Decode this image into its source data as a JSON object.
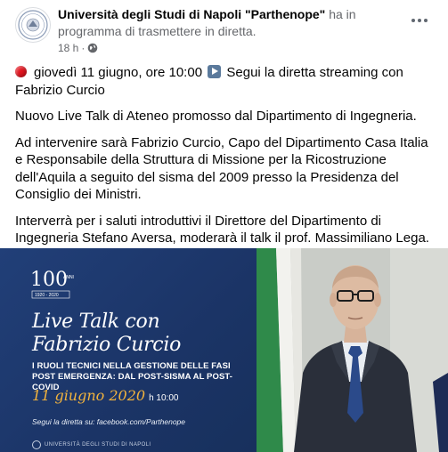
{
  "post": {
    "author_name": "Università degli Studi di Napoli \"Parthenope\"",
    "author_action": " ha in programma di trasmettere in diretta.",
    "timestamp": "18 h",
    "separator": "·",
    "privacy_icon": "globe-icon",
    "more_icon": "more-options-icon"
  },
  "body": {
    "p1_date": "giovedì 11 giugno, ore 10:00",
    "p1_rest": "Segui la diretta streaming con Fabrizio Curcio",
    "p2": "Nuovo Live Talk di Ateneo promosso dal Dipartimento di Ingegneria.",
    "p3": "Ad intervenire sarà Fabrizio Curcio, Capo del Dipartimento Casa Italia e Responsabile della Struttura di Missione per la Ricostruzione dell'Aquila a seguito del sisma del 2009 presso la Presidenza del Consiglio dei Ministri.",
    "p4": "Interverrà per i saluti introduttivi il Direttore del Dipartimento di Ingegneria Stefano Aversa, moderarà il talk il prof. Massimiliano Lega."
  },
  "image": {
    "logo_number": "100",
    "logo_word": "ANNI",
    "logo_years": "1920 - 2020",
    "title_line1": "Live Talk con",
    "title_line2": "Fabrizio Curcio",
    "subtitle": "I RUOLI TECNICI NELLA GESTIONE DELLE FASI POST EMERGENZA: DAL POST-SISMA AL POST- COVID",
    "date": "11 giugno 2020",
    "time": "h 10:00",
    "follow": "Segui la diretta su: facebook.com/Parthenope",
    "footer": "UNIVERSITÀ DEGLI STUDI DI NAPOLI"
  },
  "colors": {
    "banner_blue": "#1c3769",
    "date_gold": "#f2b33d",
    "live_dot": "#e0141e",
    "play_box": "#5b7a9c"
  }
}
